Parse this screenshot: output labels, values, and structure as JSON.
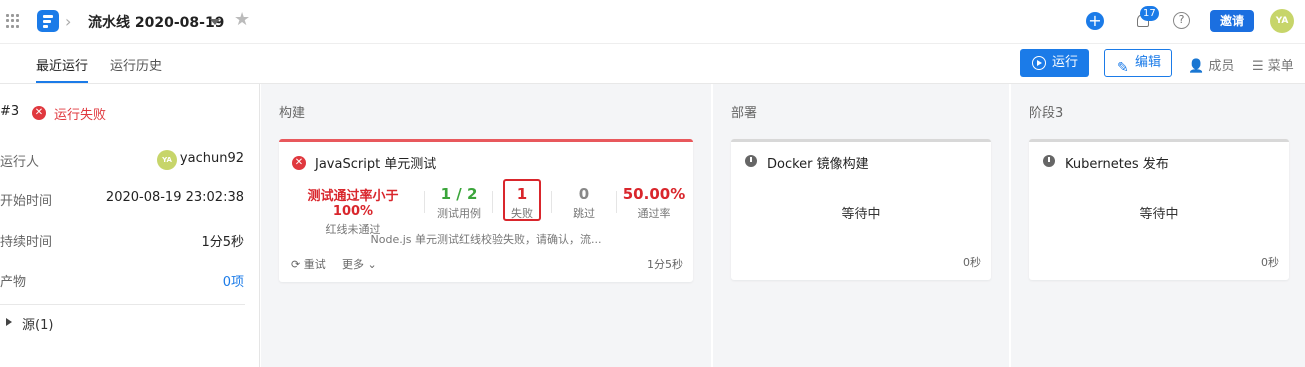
{
  "header": {
    "title": "流水线 2020-08-19",
    "notification_count": "17",
    "help_symbol": "?",
    "invite_label": "邀请",
    "avatar_initials": "YA",
    "brand_color": "#1b7be8"
  },
  "tabs": [
    {
      "label": "最近运行",
      "active": true
    },
    {
      "label": "运行历史",
      "active": false
    }
  ],
  "toolbar": {
    "run_label": "运行",
    "edit_label": "编辑",
    "members_label": "成员",
    "menu_label": "菜单"
  },
  "run_summary": {
    "number": "#3",
    "status": "运行失败",
    "status_color": "#e0383e",
    "runner_label": "运行人",
    "runner_avatar": "YA",
    "runner_name": "yachun92",
    "start_label": "开始时间",
    "start_value": "2020-08-19 23:02:38",
    "duration_label": "持续时间",
    "duration_value": "1分5秒",
    "artifacts_label": "产物",
    "artifacts_value": "0项",
    "source_label": "源(1)"
  },
  "stages": [
    {
      "title": "构建",
      "job": {
        "name": "JavaScript 单元测试",
        "status": "failed",
        "stats": [
          {
            "value": "测试通过率小于100%",
            "label": "红线未通过",
            "color": "#d9262c"
          },
          {
            "value": "1 / 2",
            "label": "测试用例",
            "color": "#3aa53a"
          },
          {
            "value": "1",
            "label": "失败",
            "color": "#d9262c"
          },
          {
            "value": "0",
            "label": "跳过",
            "color": "#888888"
          },
          {
            "value": "50.00%",
            "label": "通过率",
            "color": "#d9262c"
          }
        ],
        "message": "Node.js 单元测试红线校验失败，请确认，流...",
        "retry_label": "重试",
        "more_label": "更多",
        "duration": "1分5秒"
      }
    },
    {
      "title": "部署",
      "job": {
        "name": "Docker 镜像构建",
        "status_text": "等待中",
        "duration": "0秒"
      }
    },
    {
      "title": "阶段3",
      "job": {
        "name": "Kubernetes 发布",
        "status_text": "等待中",
        "duration": "0秒"
      }
    }
  ]
}
